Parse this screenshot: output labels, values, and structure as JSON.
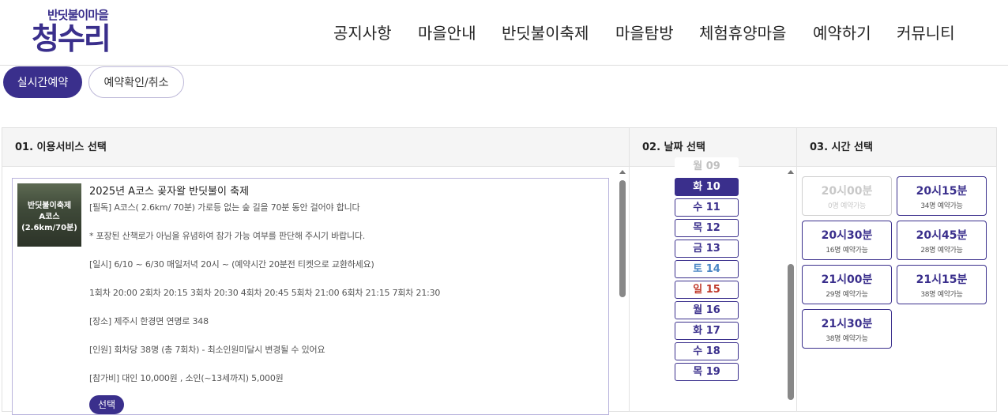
{
  "logo": {
    "small": "반딧불이마을",
    "big": "청수리"
  },
  "nav": [
    "공지사항",
    "마을안내",
    "반딧불이축제",
    "마을탐방",
    "체험휴양마을",
    "예약하기",
    "커뮤니티"
  ],
  "tabs": {
    "active": "실시간예약",
    "inactive": "예약확인/취소"
  },
  "panels": {
    "service": "01. 이용서비스 선택",
    "date": "02. 날짜 선택",
    "time": "03. 시간 선택"
  },
  "card": {
    "thumb_line1": "반딧불이축제",
    "thumb_line2": "A코스",
    "thumb_line3": "(2.6km/70분)",
    "title": "2025년 A코스 곶자왈 반딧불이 축제",
    "lines": [
      "[필독] A코스( 2.6km/ 70분)  가로등 없는 숲 길을 70분 동안 걸어야 합니다",
      "* 포장된 산책로가 아님을 유념하여 참가 가능 여부를 판단해 주시기 바랍니다.",
      "[일시] 6/10 ~ 6/30  매일저녁 20시 ~  (예약시간 20분전 티켓으로 교환하세요)",
      "1회차 20:00  2회차 20:15  3회차 20:30  4회차 20:45  5회차 21:00  6회차 21:15  7회차 21:30",
      "[장소] 제주시 한경면 연명로 348",
      "[인원] 회차당 38명  (총 7회차) - 최소인원미달시 변경될 수 있어요",
      "[참가비] 대인 10,000원 , 소인(~13세까지) 5,000원"
    ],
    "select_label": "선택"
  },
  "dates": [
    {
      "label": "월 09",
      "state": "faded"
    },
    {
      "label": "화 10",
      "state": "active"
    },
    {
      "label": "수 11",
      "state": "normal"
    },
    {
      "label": "목 12",
      "state": "normal"
    },
    {
      "label": "금 13",
      "state": "normal"
    },
    {
      "label": "토 14",
      "state": "sat"
    },
    {
      "label": "일 15",
      "state": "sun"
    },
    {
      "label": "월 16",
      "state": "normal"
    },
    {
      "label": "화 17",
      "state": "normal"
    },
    {
      "label": "수 18",
      "state": "normal"
    },
    {
      "label": "목 19",
      "state": "normal"
    }
  ],
  "times": [
    {
      "time": "20시00분",
      "status": "0명 예약가능",
      "disabled": true
    },
    {
      "time": "20시15분",
      "status": "34명 예약가능",
      "disabled": false
    },
    {
      "time": "20시30분",
      "status": "16명 예약가능",
      "disabled": false
    },
    {
      "time": "20시45분",
      "status": "28명 예약가능",
      "disabled": false
    },
    {
      "time": "21시00분",
      "status": "29명 예약가능",
      "disabled": false
    },
    {
      "time": "21시15분",
      "status": "38명 예약가능",
      "disabled": false
    },
    {
      "time": "21시30분",
      "status": "38명 예약가능",
      "disabled": false
    }
  ],
  "colors": {
    "brand": "#3a2f8c",
    "saturday": "#4a86c5",
    "sunday": "#c0392b"
  }
}
